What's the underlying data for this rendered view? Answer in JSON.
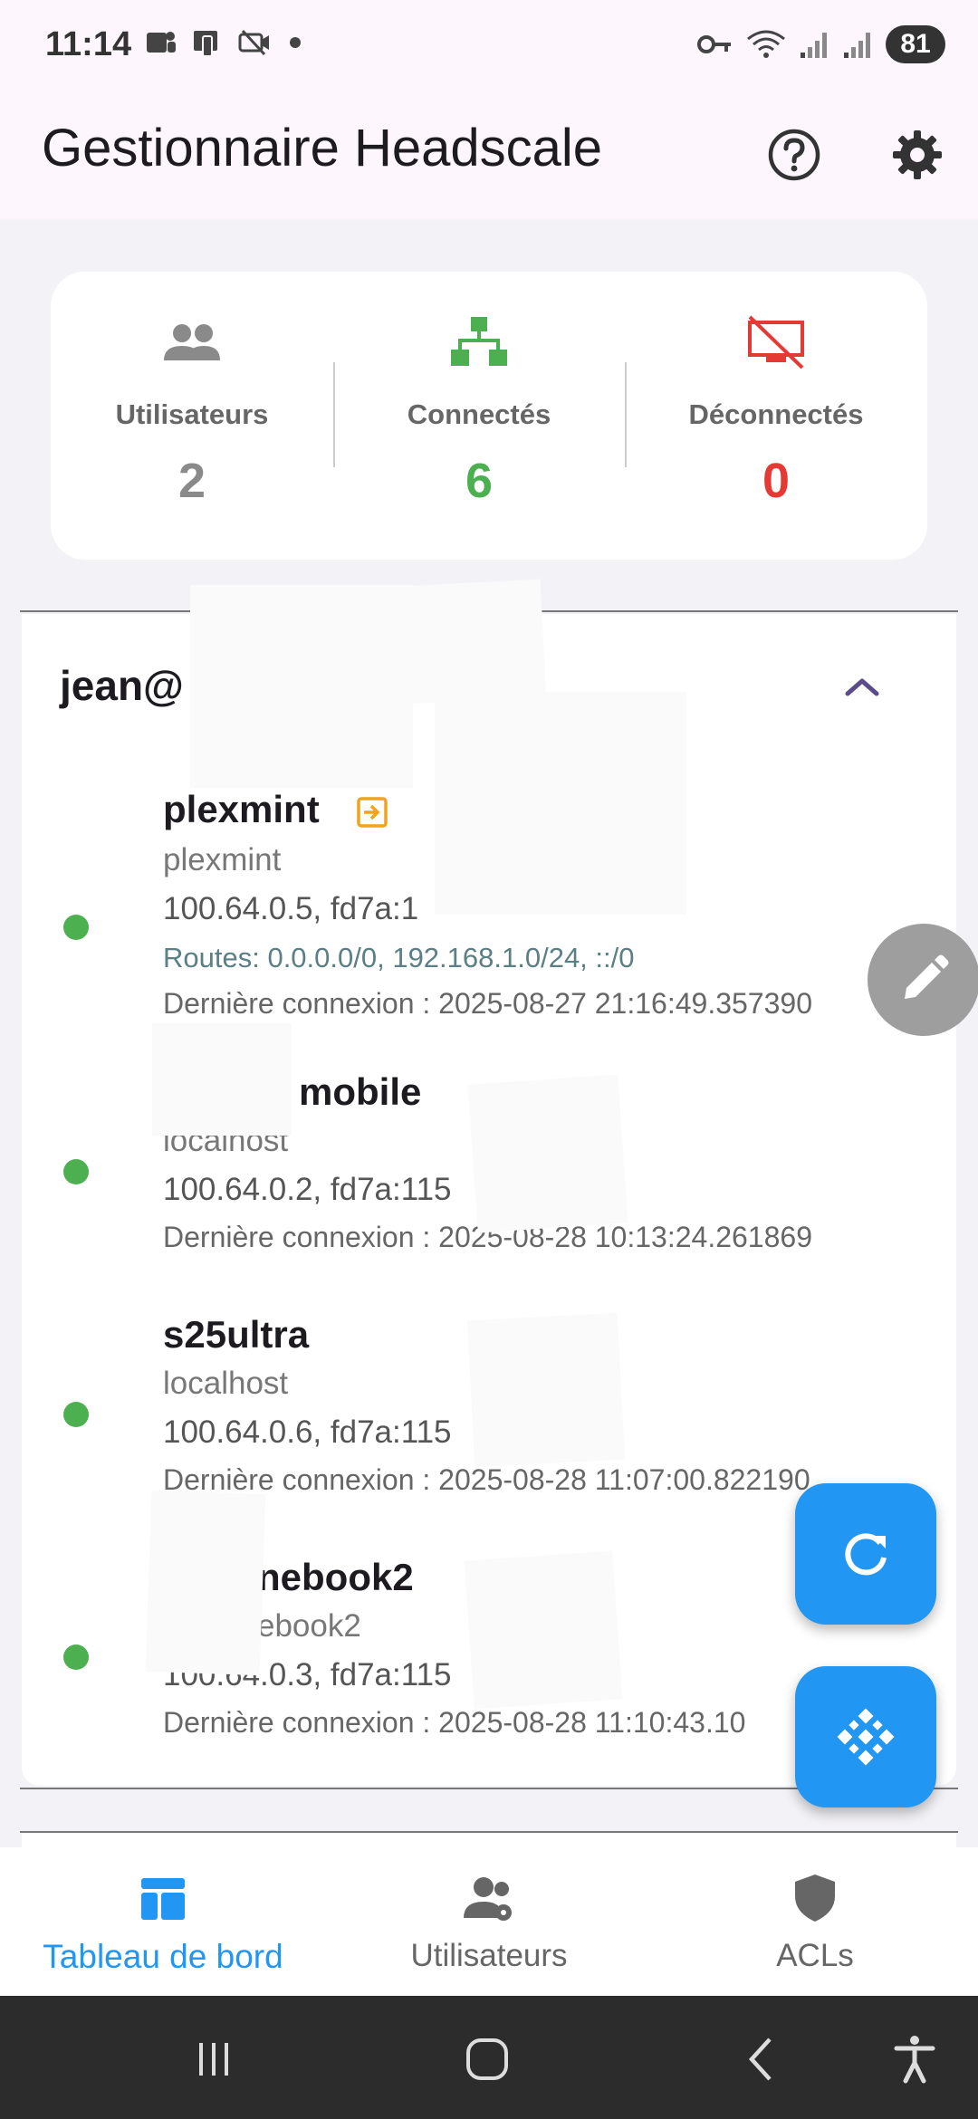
{
  "status_bar": {
    "time": "11:14",
    "battery": "81"
  },
  "app_bar": {
    "title": "Gestionnaire Headscale"
  },
  "stats": {
    "users_label": "Utilisateurs",
    "users_value": "2",
    "connected_label": "Connectés",
    "connected_value": "6",
    "disconnected_label": "Déconnectés",
    "disconnected_value": "0",
    "colors": {
      "users": "#8a8a8a",
      "connected": "#4caf50",
      "disconnected": "#e53935"
    }
  },
  "user_panel": {
    "name": "jean@",
    "nodes": [
      {
        "name": "plexmint",
        "host": "plexmint",
        "ips": "100.64.0.5, fd7a:1",
        "routes": "Routes: 0.0.0.0/0, 192.168.1.0/24, ::/0",
        "last_seen": "Dernière connexion : 2025-08-27 21:16:49.357390",
        "exit_node_icon": "exit-node-icon"
      },
      {
        "name": "mobile",
        "host": "localhost",
        "ips": "100.64.0.2, fd7a:115",
        "last_seen": "Dernière connexion : 2025-08-28 10:13:24.261869"
      },
      {
        "name": "s25ultra",
        "host": "localhost",
        "ips": "100.64.0.6, fd7a:115",
        "last_seen": "Dernière connexion : 2025-08-28 11:07:00.822190"
      },
      {
        "name": "nebook2",
        "host": "ebook2",
        "ips": "100.64.0.3, fd7a:115",
        "last_seen": "Dernière connexion : 2025-08-28 11:10:43.10"
      }
    ]
  },
  "bottom_nav": {
    "dashboard": "Tableau de bord",
    "users": "Utilisateurs",
    "acls": "ACLs",
    "active_color": "#2196f3"
  },
  "fab_color": "#2196f3"
}
